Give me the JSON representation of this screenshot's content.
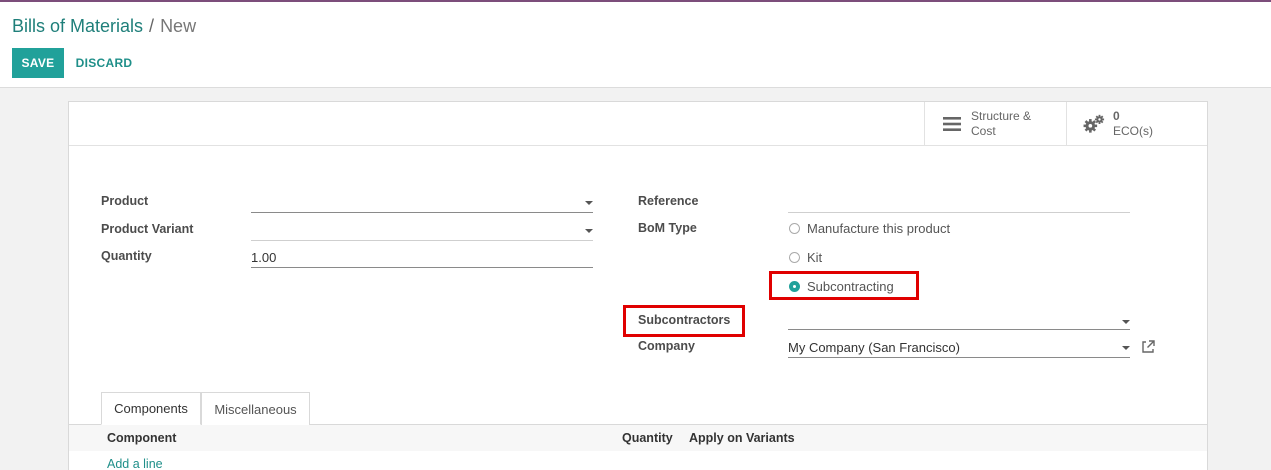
{
  "breadcrumb": {
    "parent": "Bills of Materials",
    "separator": "/",
    "current": "New"
  },
  "toolbar": {
    "save_label": "SAVE",
    "discard_label": "DISCARD"
  },
  "stat_buttons": {
    "structure": {
      "line1": "Structure &",
      "line2": "Cost",
      "icon": "list-icon"
    },
    "eco": {
      "count": "0",
      "label": "ECO(s)",
      "icon": "gears-icon"
    }
  },
  "form": {
    "product_label": "Product",
    "product_value": "",
    "variant_label": "Product Variant",
    "variant_value": "",
    "quantity_label": "Quantity",
    "quantity_value": "1.00",
    "reference_label": "Reference",
    "reference_value": "",
    "bom_type_label": "BoM Type",
    "bom_types": [
      {
        "label": "Manufacture this product",
        "checked": false
      },
      {
        "label": "Kit",
        "checked": false
      },
      {
        "label": "Subcontracting",
        "checked": true
      }
    ],
    "subcontractors_label": "Subcontractors",
    "subcontractors_value": "",
    "company_label": "Company",
    "company_value": "My Company (San Francisco)"
  },
  "notebook": {
    "tabs": [
      "Components",
      "Miscellaneous"
    ],
    "columns": [
      "Component",
      "Quantity",
      "Apply on Variants"
    ],
    "add_line": "Add a line"
  },
  "colors": {
    "accent": "#21a19a",
    "link": "#1f8f89",
    "highlight": "#e00000",
    "topbar": "#7c4d7b"
  }
}
